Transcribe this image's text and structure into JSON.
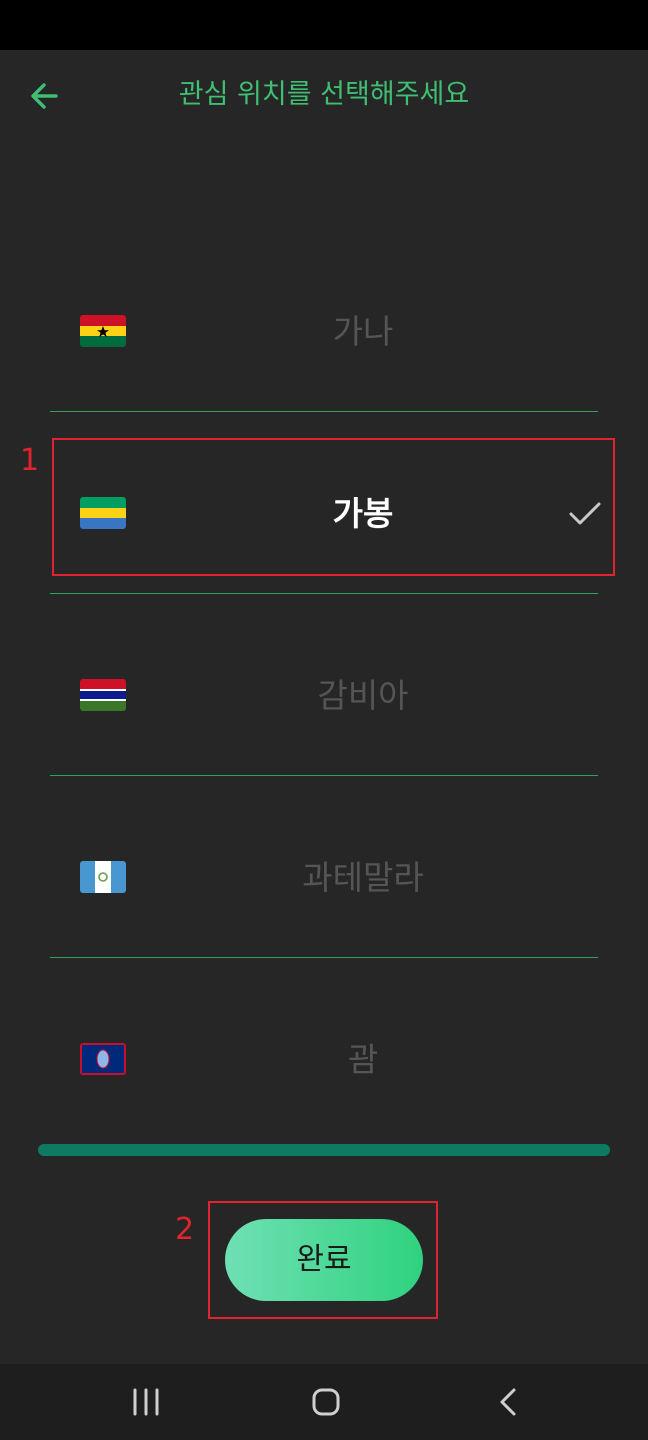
{
  "header": {
    "title": "관심 위치를 선택해주세요",
    "back_icon": "arrow-left-icon"
  },
  "countries": [
    {
      "name": "가나",
      "flag": "ghana-flag-icon",
      "selected": false
    },
    {
      "name": "가봉",
      "flag": "gabon-flag-icon",
      "selected": true
    },
    {
      "name": "감비아",
      "flag": "gambia-flag-icon",
      "selected": false
    },
    {
      "name": "과테말라",
      "flag": "guatemala-flag-icon",
      "selected": false
    },
    {
      "name": "괌",
      "flag": "guam-flag-icon",
      "selected": false
    }
  ],
  "annotations": {
    "label_1": "1",
    "label_2": "2"
  },
  "done_button": {
    "label": "완료"
  },
  "colors": {
    "accent": "#3fbf73",
    "highlight": "#e0242f",
    "background": "#262626"
  },
  "navbar": {
    "recent_icon": "recent-apps-icon",
    "home_icon": "home-icon",
    "back_icon": "nav-back-icon"
  }
}
